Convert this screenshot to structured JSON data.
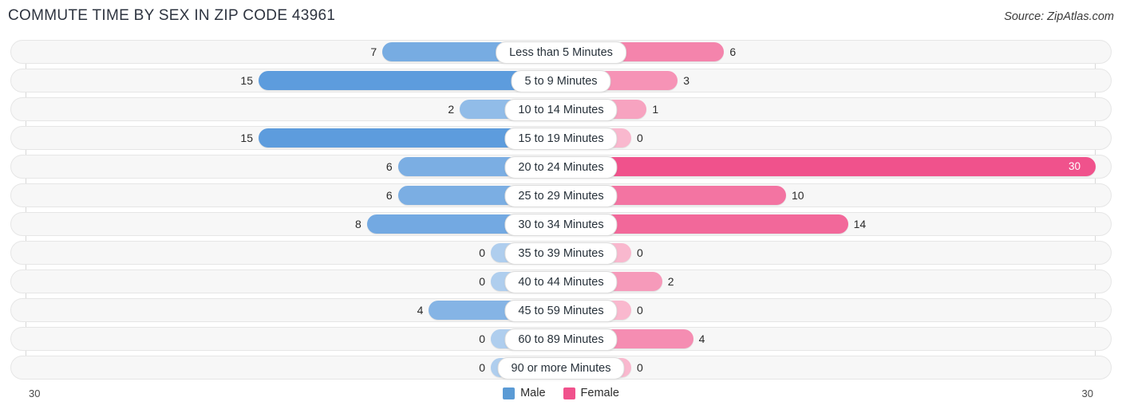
{
  "header": {
    "title": "COMMUTE TIME BY SEX IN ZIP CODE 43961",
    "source": "Source: ZipAtlas.com"
  },
  "legend": {
    "male_label": "Male",
    "female_label": "Female",
    "male_color": "#5B9BD5",
    "female_color": "#F0528C"
  },
  "axis": {
    "left_tick": "30",
    "right_tick": "30",
    "max": 30
  },
  "chart_data": {
    "type": "bar",
    "title": "COMMUTE TIME BY SEX IN ZIP CODE 43961",
    "subtitle": "Source: ZipAtlas.com",
    "orientation": "horizontal-diverging",
    "xlabel": "",
    "ylabel": "",
    "xlim": [
      30,
      30
    ],
    "grid": false,
    "legend_position": "bottom-center",
    "categories": [
      "Less than 5 Minutes",
      "5 to 9 Minutes",
      "10 to 14 Minutes",
      "15 to 19 Minutes",
      "20 to 24 Minutes",
      "25 to 29 Minutes",
      "30 to 34 Minutes",
      "35 to 39 Minutes",
      "40 to 44 Minutes",
      "45 to 59 Minutes",
      "60 to 89 Minutes",
      "90 or more Minutes"
    ],
    "series": [
      {
        "name": "Male",
        "color": "#5B9BD5",
        "side": "left",
        "values": [
          7,
          15,
          2,
          15,
          6,
          6,
          8,
          0,
          0,
          4,
          0,
          0
        ],
        "labels": [
          "7",
          "15",
          "2",
          "15",
          "6",
          "6",
          "8",
          "0",
          "0",
          "4",
          "0",
          "0"
        ]
      },
      {
        "name": "Female",
        "color": "#F0528C",
        "side": "right",
        "values": [
          6,
          3,
          1,
          0,
          30,
          10,
          14,
          0,
          2,
          0,
          4,
          0
        ],
        "labels": [
          "6",
          "3",
          "1",
          "0",
          "30",
          "10",
          "14",
          "0",
          "2",
          "0",
          "4",
          "0"
        ]
      }
    ]
  }
}
